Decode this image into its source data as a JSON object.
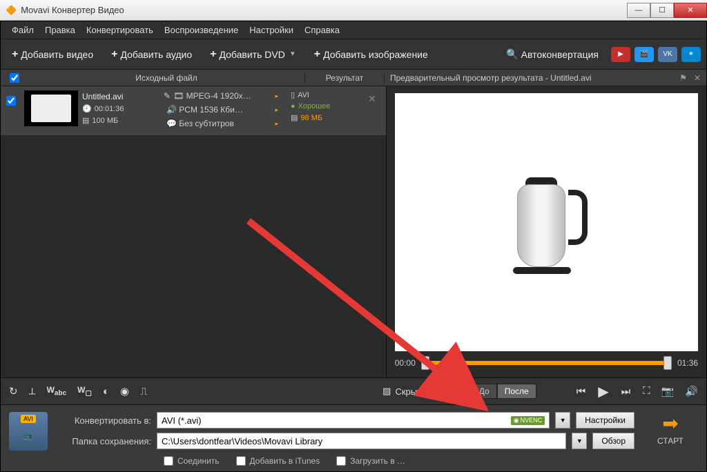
{
  "window": {
    "title": "Movavi Конвертер Видео"
  },
  "menu": {
    "file": "Файл",
    "edit": "Правка",
    "convert": "Конвертировать",
    "playback": "Воспроизведение",
    "settings": "Настройки",
    "help": "Справка"
  },
  "toolbar": {
    "add_video": "Добавить видео",
    "add_audio": "Добавить аудио",
    "add_dvd": "Добавить DVD",
    "add_image": "Добавить изображение",
    "autoconvert": "Автоконвертация"
  },
  "columns": {
    "source": "Исходный файл",
    "result": "Результат",
    "preview": "Предварительный просмотр результата - Untitled.avi"
  },
  "file": {
    "name": "Untitled.avi",
    "duration": "00:01:36",
    "size": "100 МБ",
    "codec": "MPEG-4 1920x…",
    "audio": "PCM 1536 Кби…",
    "subs": "Без субтитров",
    "out_format": "AVI",
    "quality": "Хорошее",
    "out_size": "98 МБ"
  },
  "timeline": {
    "start": "00:00",
    "end": "01:36"
  },
  "controls": {
    "hide_player": "Скрыть плеер",
    "before": "До",
    "after": "После"
  },
  "bottom": {
    "convert_to_lbl": "Конвертировать в:",
    "convert_to_val": "AVI (*.avi)",
    "save_to_lbl": "Папка сохранения:",
    "save_to_val": "C:\\Users\\dontfear\\Videos\\Movavi Library",
    "settings_btn": "Настройки",
    "browse_btn": "Обзор",
    "nvenc": "NVENC",
    "join": "Соединить",
    "itunes": "Добавить в iTunes",
    "upload": "Загрузить в …",
    "start": "СТАРТ",
    "fmt_tag": "AVI"
  }
}
